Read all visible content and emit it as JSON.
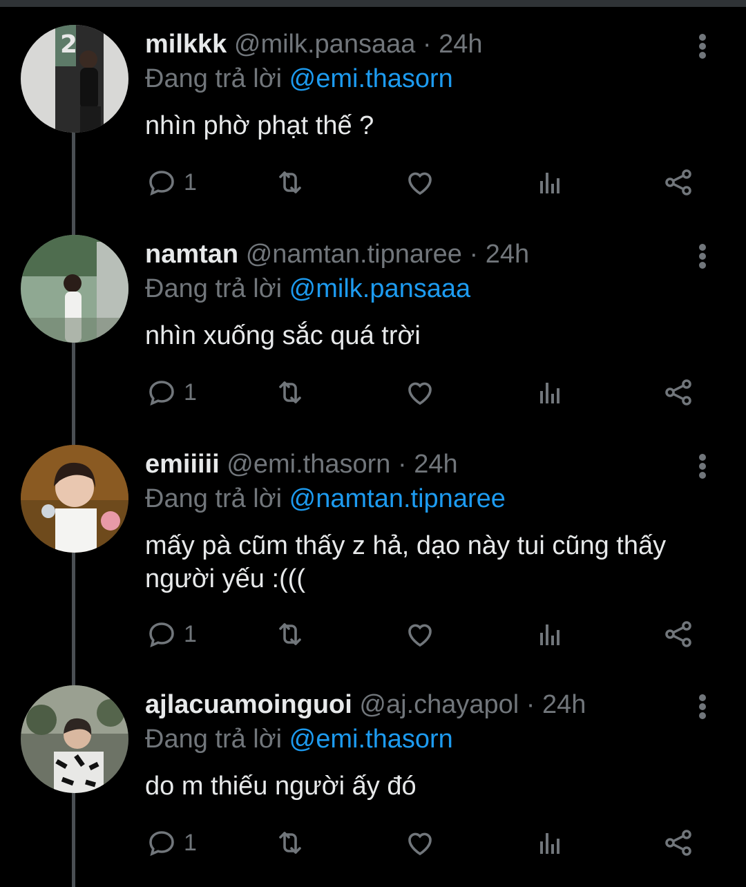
{
  "tweets": [
    {
      "name": "milkkk",
      "handle": "@milk.pansaaa",
      "time": "24h",
      "reply_prefix": "Đang trả lời",
      "reply_to": "@emi.thasorn",
      "text": "nhìn phờ phạt thế ?",
      "reply_count": "1"
    },
    {
      "name": "namtan",
      "handle": "@namtan.tipnaree",
      "time": "24h",
      "reply_prefix": "Đang trả lời",
      "reply_to": "@milk.pansaaa",
      "text": "nhìn xuống sắc quá trời",
      "reply_count": "1"
    },
    {
      "name": "emiiiii",
      "handle": "@emi.thasorn",
      "time": "24h",
      "reply_prefix": "Đang trả lời",
      "reply_to": "@namtan.tipnaree",
      "text": "mấy pà cũm thấy z hả, dạo này tui cũng thấy người yếu :(((",
      "reply_count": "1"
    },
    {
      "name": "ajlacuamoinguoi",
      "handle": "@aj.chayapol",
      "time": "24h",
      "reply_prefix": "Đang trả lời",
      "reply_to": "@emi.thasorn",
      "text": "do m thiếu người ấy đó",
      "reply_count": "1"
    }
  ],
  "separator": "·",
  "icons": [
    "reply-icon",
    "retweet-icon",
    "like-icon",
    "views-icon",
    "share-icon",
    "more-icon"
  ],
  "colors": {
    "background": "#000000",
    "text": "#e7e9ea",
    "secondary": "#71767b",
    "mention": "#1d9bf0",
    "thread_line": "#4a4f53"
  }
}
